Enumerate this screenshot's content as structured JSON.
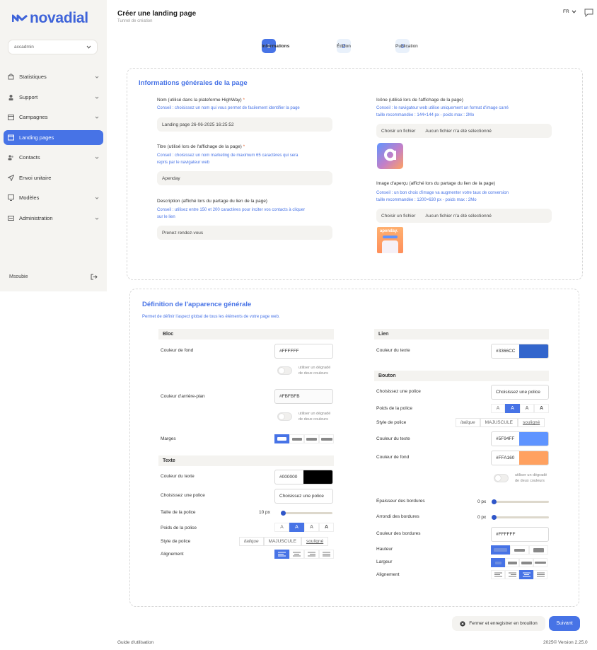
{
  "brand": {
    "name": "novadial",
    "accent": "#4773e6"
  },
  "sidebar": {
    "account": "accadmin",
    "items": [
      {
        "label": "Statistiques",
        "icon": "home-icon",
        "chevron": true
      },
      {
        "label": "Support",
        "icon": "user-icon",
        "chevron": true
      },
      {
        "label": "Campagnes",
        "icon": "calendar-icon",
        "chevron": true
      },
      {
        "label": "Landing pages",
        "icon": "window-icon",
        "chevron": false,
        "active": true
      },
      {
        "label": "Contacts",
        "icon": "contacts-icon",
        "chevron": true
      },
      {
        "label": "Envoi unitaire",
        "icon": "send-icon",
        "chevron": false
      },
      {
        "label": "Modèles",
        "icon": "template-icon",
        "chevron": true
      },
      {
        "label": "Administration",
        "icon": "admin-icon",
        "chevron": true
      }
    ],
    "user": "Msoubie"
  },
  "header": {
    "title": "Créer une landing page",
    "subtitle": "Tunnel de création",
    "lang": "FR"
  },
  "steps": [
    {
      "num": "1",
      "label": "Informations",
      "active": true
    },
    {
      "num": "2",
      "label": "Édition",
      "active": false
    },
    {
      "num": "3",
      "label": "Publication",
      "active": false
    }
  ],
  "info": {
    "title": "Informations générales de la page",
    "name_label": "Nom (utilisé dans la plateforme HighWay)",
    "required_mark": "*",
    "name_hint": "Conseil : choisissez un nom qui vous permet de facilement identifier la page",
    "name_value": "Landing page 26-06-2025 16:25:52",
    "title_label": "Titre (utilisé lors de l'affichage de la page)",
    "title_hint_1": "Conseil : choisissez un nom marketing de maximum 65 caractères qui sera",
    "title_hint_2": "repris par le navigateur web",
    "title_value": "Apenday",
    "desc_label": "Description (affiché lors du partage du lien de la page)",
    "desc_hint_1": "Conseil : utilisez entre 150 et 200 caractères pour inciter vos contacts à cliquer",
    "desc_hint_2": "sur le lien",
    "desc_value": "Prenez rendez-vous",
    "icon_label": "Icône (utilisé lors de l'affichage de la page)",
    "icon_hint_1": "Conseil : le navigateur web utilise uniquement un format d'image carré",
    "icon_hint_2": "taille recommandée : 144×144 px - poids max : 2Mo",
    "choose_file": "Choisir un fichier",
    "no_file": "Aucun fichier n'a été sélectionné",
    "preview_label": "Image d'aperçu (affiché lors du partage du lien de la page)",
    "preview_hint_1": "Conseil : un bon choix d'image va augmenter votre taux de conversion",
    "preview_hint_2": "taille recommandée : 1200×630 px - poids max : 2Mo",
    "preview_logo_text": "apenday."
  },
  "appearance": {
    "title": "Définition de l'apparence générale",
    "subtitle": "Permet de définir l'aspect global de tous les éléments de votre page web.",
    "bloc": {
      "title": "Bloc",
      "bg_label": "Couleur de fond",
      "bg_value": "#FFFFFF",
      "gradient_1": "utiliser un dégradé",
      "gradient_2": "de deux couleurs",
      "back_label": "Couleur d'arrière-plan",
      "back_value": "#FBFBFB",
      "margin_label": "Marges"
    },
    "texte": {
      "title": "Texte",
      "color_label": "Couleur du texte",
      "color_value": "#000000",
      "color_swatch": "#000000",
      "font_label": "Choisissez une police",
      "font_value": "Choisissez une police",
      "size_label": "Taille de la police",
      "size_value": "10 px",
      "weight_label": "Poids de la police",
      "weights": [
        "A",
        "A",
        "A",
        "A"
      ],
      "style_label": "Style de police",
      "styles": [
        "italique",
        "MAJUSCULE",
        "souligné"
      ],
      "align_label": "Alignement"
    },
    "lien": {
      "title": "Lien",
      "color_label": "Couleur du texte",
      "color_value": "#3366CC",
      "color_swatch": "#3366CC"
    },
    "bouton": {
      "title": "Bouton",
      "font_label": "Choisissez une police",
      "font_value": "Choisissez une police",
      "weight_label": "Poids de la police",
      "style_label": "Style de police",
      "text_color_label": "Couleur du texte",
      "text_color_value": "#5F94FF",
      "text_color_swatch": "#5F94FF",
      "bg_label": "Couleur de fond",
      "bg_value": "#FFA160",
      "bg_swatch": "#FFA160",
      "border_width_label": "Épaisseur des bordures",
      "border_width_value": "0 px",
      "radius_label": "Arrondi des bordures",
      "radius_value": "0 px",
      "border_color_label": "Couleur des bordures",
      "border_color_value": "#FFFFFF",
      "height_label": "Hauteur",
      "width_label": "Largeur",
      "align_label": "Alignement"
    }
  },
  "footer": {
    "close_label": "Fermer et enregistrer en brouillon",
    "next_label": "Suivant",
    "guide": "Guide d'utilisation",
    "version": "2025© Version 2.25.0"
  }
}
